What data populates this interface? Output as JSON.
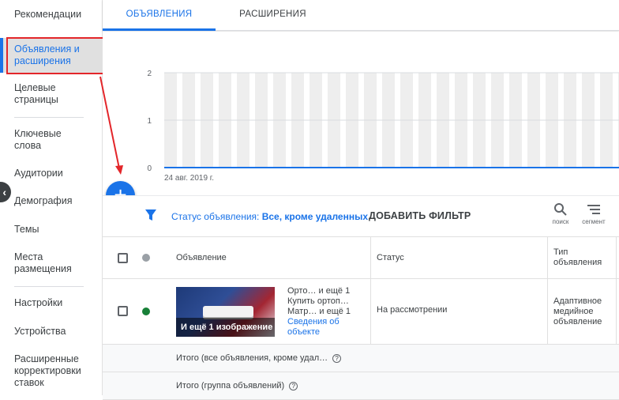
{
  "sidebar": {
    "items": [
      {
        "label": "Рекомендации"
      },
      {
        "label": "Объявления и расширения"
      },
      {
        "label": "Целевые страницы"
      },
      {
        "label": "Ключевые слова"
      },
      {
        "label": "Аудитории"
      },
      {
        "label": "Демография"
      },
      {
        "label": "Темы"
      },
      {
        "label": "Места размещения"
      },
      {
        "label": "Настройки"
      },
      {
        "label": "Устройства"
      },
      {
        "label": "Расширенные корректировки ставок"
      }
    ],
    "active_index": 1
  },
  "tabs": [
    {
      "label": "ОБЪЯВЛЕНИЯ",
      "active": true
    },
    {
      "label": "РАСШИРЕНИЯ",
      "active": false
    }
  ],
  "chart_data": {
    "type": "line",
    "x": [
      "24 авг. 2019 г."
    ],
    "series": [
      {
        "values": [
          0
        ]
      }
    ],
    "ylim": [
      0,
      2
    ],
    "yticks": [
      "2",
      "1",
      "0"
    ],
    "xlabel": "",
    "ylabel": "",
    "grid": true
  },
  "fab": {
    "icon": "plus-icon",
    "label": "+"
  },
  "filter": {
    "status_label": "Статус объявления:",
    "status_value": "Все, кроме удаленных",
    "add_filter": "ДОБАВИТЬ ФИЛЬТР",
    "tools": [
      {
        "icon": "search-icon",
        "label": "поиск"
      },
      {
        "icon": "segment-icon",
        "label": "сегмент"
      }
    ]
  },
  "table": {
    "headers": {
      "ad": "Объявление",
      "status": "Статус",
      "type": "Тип объявления"
    },
    "rows": [
      {
        "status_dot": "#188038",
        "ad_lines": [
          "Орто…   и ещё 1",
          "Купить ортоп…",
          "Матр…   и ещё 1"
        ],
        "ad_link": "Сведения об объекте",
        "thumb_badge": "И ещё 1 изображение",
        "status": "На рассмотрении",
        "type": "Адаптивное медийное объявление"
      }
    ],
    "totals": [
      {
        "label": "Итого (все объявления, кроме удал…"
      },
      {
        "label": "Итого (группа объявлений)"
      }
    ]
  },
  "colors": {
    "accent": "#1a73e8",
    "highlight": "#e3262a",
    "status_green": "#188038"
  }
}
